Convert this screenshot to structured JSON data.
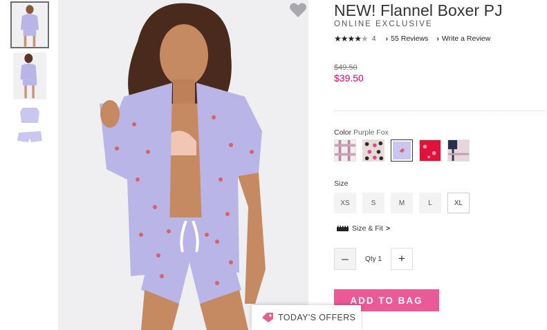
{
  "product": {
    "title": "NEW! Flannel Boxer PJ",
    "subtitle": "ONLINE EXCLUSIVE",
    "rating_stars": "★★★★",
    "rating_half": "★",
    "rating_value": "4",
    "reviews_label": "55 Reviews",
    "write_review_label": "Write a Review",
    "price_original": "$49.50",
    "price_sale": "$39.50",
    "favorite_icon": "heart-icon"
  },
  "color": {
    "label": "Color",
    "selected": "Purple Fox",
    "swatches": [
      {
        "name": "plaid-pink",
        "accent": "#b98aa0"
      },
      {
        "name": "leopard",
        "accent": "#d84a8e"
      },
      {
        "name": "purple-fox",
        "accent": "#b9b5e6"
      },
      {
        "name": "red-floral",
        "accent": "#e0123c"
      },
      {
        "name": "navy-plaid",
        "accent": "#2a2f4a"
      }
    ]
  },
  "size": {
    "label": "Size",
    "options": [
      "XS",
      "S",
      "M",
      "L",
      "XL"
    ],
    "size_fit_label": "Size & Fit",
    "size_fit_chevron": ">"
  },
  "quantity": {
    "minus": "–",
    "label": "Qty 1",
    "plus": "+"
  },
  "cta": {
    "add_to_bag": "ADD TO BAG"
  },
  "offers": {
    "label": "TODAY'S OFFERS"
  },
  "colors": {
    "accent_pink": "#ea5a97",
    "sale_price": "#d6006f",
    "pajama_lavender": "#b9b5e6"
  }
}
